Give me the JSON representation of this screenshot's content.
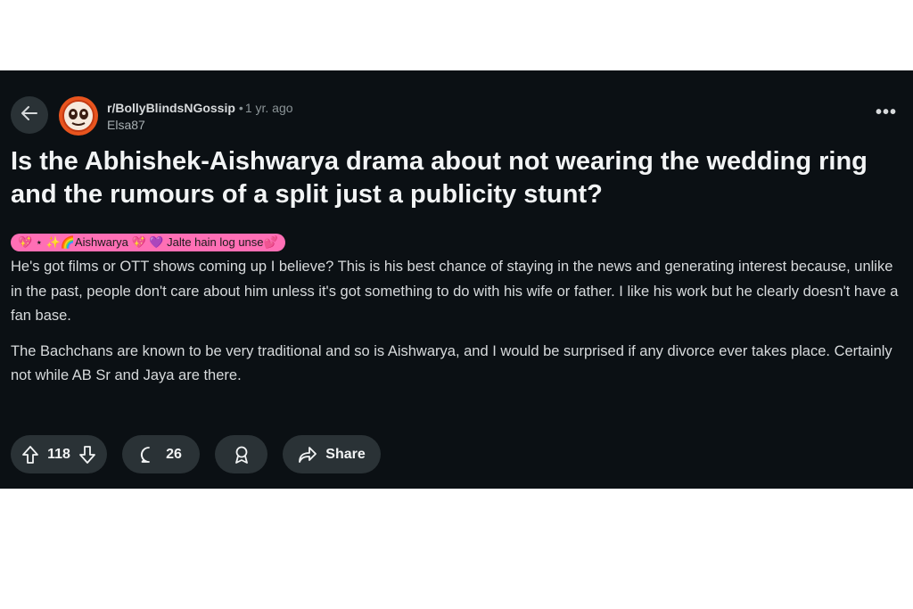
{
  "post": {
    "subreddit": "r/BollyBlindsNGossip",
    "separator": "•",
    "time": "1 yr. ago",
    "username": "Elsa87",
    "more_label": "•••",
    "title": "Is the Abhishek-Aishwarya drama about not wearing the wedding ring and the rumours of a split just a publicity stunt?",
    "flair": "💖 ⋆ ✨🌈Aishwarya 💖 💜 Jalte hain log unse💕",
    "paragraphs": [
      "He's got films or OTT shows coming up I believe? This is his best chance of staying in the news and generating interest because, unlike in the past, people don't care about him unless it's got something to do with his wife or father. I like his work but he clearly doesn't have a fan base.",
      "The Bachchans are known to be very traditional and so is Aishwarya, and I would be surprised if any divorce ever takes place. Certainly not while AB Sr and Jaya are there."
    ]
  },
  "actions": {
    "vote_count": "118",
    "comment_count": "26",
    "share_label": "Share"
  },
  "icons": {
    "back": "arrow-left-icon",
    "upvote": "arrow-up-icon",
    "downvote": "arrow-down-icon",
    "comment": "speech-bubble-icon",
    "award": "award-ribbon-icon",
    "share": "share-arrow-icon"
  },
  "colors": {
    "background": "#0b1014",
    "pill": "#2a3236",
    "avatar": "#e8541e",
    "flair": "#ff6fb5",
    "text": "#d7dadc"
  }
}
